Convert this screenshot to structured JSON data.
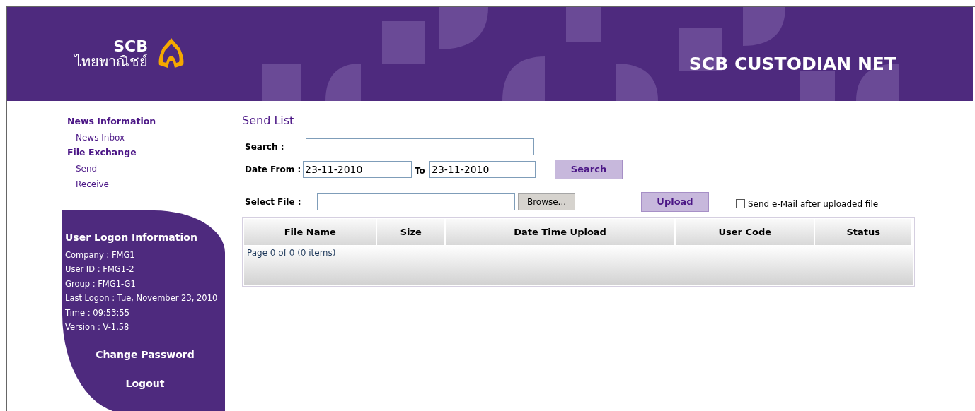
{
  "header": {
    "logo": {
      "name": "SCB",
      "thai_name": "ไทยพาณิชย์"
    },
    "title": "SCB CUSTODIAN NET"
  },
  "sidebar": {
    "menu": [
      {
        "label": "News Information",
        "children": [
          {
            "label": "News Inbox"
          }
        ]
      },
      {
        "label": "File Exchange",
        "children": [
          {
            "label": "Send"
          },
          {
            "label": "Receive"
          }
        ]
      }
    ],
    "logon": {
      "title": "User Logon Information",
      "lines": [
        "Company : FMG1",
        "User ID : FMG1-2",
        "Group : FMG1-G1",
        "Last Logon : Tue, November 23, 2010",
        "Time : 09:53:55",
        "Version : V-1.58"
      ],
      "links": [
        "Change Password",
        "Logout"
      ]
    }
  },
  "main": {
    "title": "Send List",
    "search": {
      "label": "Search :"
    },
    "date_from": {
      "label": "Date From :",
      "value": "23-11-2010"
    },
    "date_to": {
      "label": "To",
      "value": "23-11-2010"
    },
    "search_button": "Search",
    "select_file": {
      "label": "Select File :"
    },
    "browse_button": "Browse...",
    "upload_button": "Upload",
    "email_option": {
      "label": "Send e-Mail after uploaded file",
      "checked": false
    },
    "table": {
      "columns": [
        "File Name",
        "Size",
        "Date Time Upload",
        "User Code",
        "Status"
      ],
      "pager": "Page 0 of 0 (0 items)"
    }
  }
}
